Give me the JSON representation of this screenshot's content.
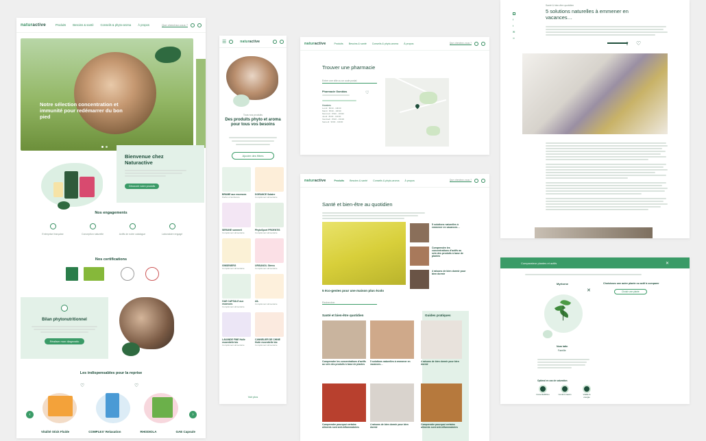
{
  "brand": {
    "logo_a": "natur",
    "logo_b": "active"
  },
  "nav": {
    "item1": "Produits",
    "item2": "Besoins & santé",
    "item3": "Conseils & phyto-aroma",
    "item4": "À propos",
    "search_placeholder": "Que cherchez-vous ?"
  },
  "home": {
    "hero_title": "Notre sélection concentration et immunité pour redémarrer du bon pied",
    "welcome_title": "Bienvenue chez Naturactive",
    "welcome_btn": "Découvrir notre produits",
    "engagements_title": "Nos engagements",
    "engagements": [
      "Entreprise française",
      "Conception naturelle",
      "Actifs de notre catalogue",
      "Laboratoire engagé"
    ],
    "certifications_title": "Nos certifications",
    "bilan_title": "Bilan phytonutritionnel",
    "bilan_btn": "Réaliser mon diagnostic",
    "reprise_title": "Les indispensables pour la reprise",
    "products": [
      "Vitalité Stick Fluide",
      "COMPLEX' Relaxation",
      "RHODIOLA",
      "GAE Capsule"
    ]
  },
  "mobile": {
    "kicker": "Tous nos produits",
    "title": "Des produits phyto et aroma pour tous vos besoins",
    "filter_btn": "Ajouter des filtres",
    "products": [
      {
        "name": "BRUME aux essences",
        "sub": "Parfum d'ambiance"
      },
      {
        "name": "DORANCE Solaire",
        "sub": "Complément alimentaire"
      },
      {
        "name": "SERUNE sommeil",
        "sub": "Complément alimentaire"
      },
      {
        "name": "PhytoSport PROENTIS",
        "sub": "Complément alimentaire"
      },
      {
        "name": "GINSENERG",
        "sub": "Complément alimentaire"
      },
      {
        "name": "URISANOL Stress",
        "sub": "Complément alimentaire"
      },
      {
        "name": "GAE CAPSULE aux essences",
        "sub": "Complément alimentaire"
      },
      {
        "name": "AIL",
        "sub": "Complément alimentaire"
      },
      {
        "name": "LAVANDE FINE Huile essentielle bio",
        "sub": "Complément alimentaire"
      },
      {
        "name": "CANNELIER DE CHINE Huile essentielle bio",
        "sub": "Complément alimentaire"
      }
    ],
    "more_btn": "Voir plus"
  },
  "pharmacy": {
    "title": "Trouver une pharmacie",
    "search_placeholder": "Entrer une ville ou un code postal",
    "result_name": "Pharmacie Gambias",
    "hours_title": "Horaires",
    "hours": [
      "Lundi : 8h30 - 19h30",
      "Mardi : 8h30 - 19h30",
      "Mercredi : 8h30 - 19h30",
      "Jeudi : 8h30 - 19h30",
      "Vendredi : 8h30 - 19h30",
      "Samedi : 9h00 - 19h00"
    ]
  },
  "health": {
    "title": "Santé et bien-être au quotidien",
    "main_caption": "5 éco-gestes pour une maison plus écolo",
    "side_articles": [
      "5 solutions naturelles à emmener en vacances…",
      "Comprendre les concentrations d'actifs au sein des produits à base de plantes",
      "4 raisons de bien dormir pour bien dormir"
    ],
    "search_placeholder": "Rechercher",
    "section_title": "Santé et bien-être quotidien",
    "guides_title": "Guides pratiques",
    "cards": [
      "Comprendre les concentrations d'actifs au sein des produits à base de plantes",
      "5 solutions naturelles à emmener en vacances…",
      "4 raisons de bien dormir pour bien dormir",
      "Comprendre pourquoi certains aliments sont anti-inflammatoires",
      "4 raisons de bien dormir pour bien dormir",
      "Comprendre pourquoi certains aliments sont anti-inflammatoires"
    ]
  },
  "article": {
    "kicker": "Santé & bien-être quotidien",
    "title": "5 solutions naturelles à emmener en vacances…"
  },
  "modal": {
    "header": "Comparateur plantes et actifs",
    "plant_name": "Myrtorne",
    "compare_prompt": "Choisissez une autre plante ou actif à comparer",
    "compare_btn": "Choisir une plante",
    "latin_label": "Nom latin",
    "family_label": "Famille",
    "icons_title": "Optimal en cas de saturation",
    "icon_labels": [
      "Immunité/Rhino",
      "Confort intestin",
      "Vitalité & énergie"
    ]
  },
  "colors": {
    "accent": "#3a9b67",
    "dark": "#1d4d3a",
    "mint": "#e3f1e8"
  }
}
